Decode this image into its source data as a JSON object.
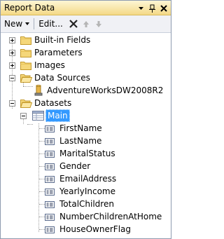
{
  "window": {
    "title": "Report Data"
  },
  "toolbar": {
    "new_label": "New",
    "edit_label": "Edit..."
  },
  "tree": {
    "builtin_fields": "Built-in Fields",
    "parameters": "Parameters",
    "images": "Images",
    "data_sources": "Data Sources",
    "data_source_item": "AdventureWorksDW2008R2",
    "datasets": "Datasets",
    "dataset_main": "Main",
    "fields": [
      "FirstName",
      "LastName",
      "MaritalStatus",
      "Gender",
      "EmailAddress",
      "YearlyIncome",
      "TotalChildren",
      "NumberChildrenAtHome",
      "HouseOwnerFlag"
    ]
  }
}
